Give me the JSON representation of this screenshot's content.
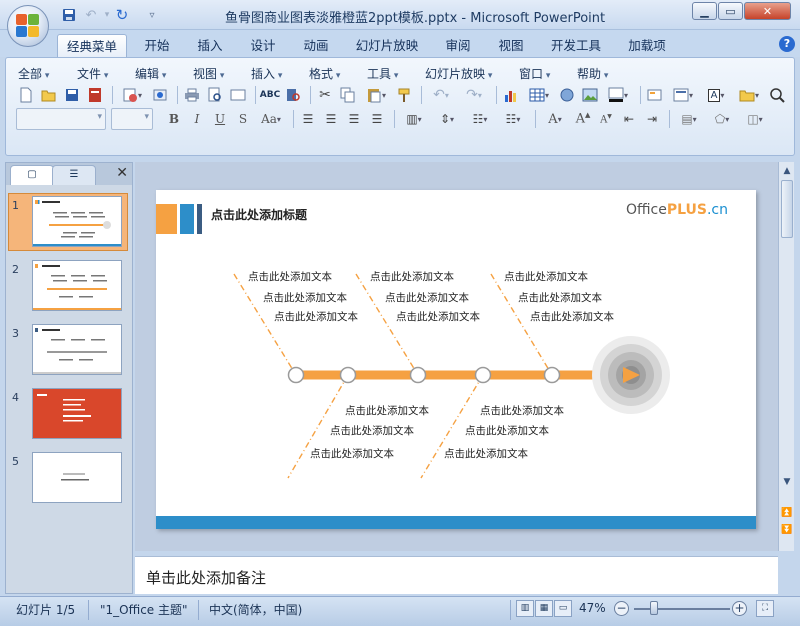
{
  "window": {
    "title": "鱼骨图商业图表淡雅橙蓝2ppt模板.pptx - Microsoft PowerPoint"
  },
  "ribbon_tabs": [
    {
      "label": "经典菜单",
      "active": true
    },
    {
      "label": "开始"
    },
    {
      "label": "插入"
    },
    {
      "label": "设计"
    },
    {
      "label": "动画"
    },
    {
      "label": "幻灯片放映"
    },
    {
      "label": "审阅"
    },
    {
      "label": "视图"
    },
    {
      "label": "开发工具"
    },
    {
      "label": "加载项"
    }
  ],
  "classic_menus": [
    "全部",
    "文件",
    "编辑",
    "视图",
    "插入",
    "格式",
    "工具",
    "幻灯片放映",
    "窗口",
    "帮助"
  ],
  "toolbar_icons": {
    "row1": [
      "new-icon",
      "open-icon",
      "save-icon",
      "pdf-icon",
      "permission-icon",
      "publish-icon",
      "print-icon",
      "print-preview-icon",
      "page-setup-icon",
      "spelling-icon",
      "research-icon",
      "cut-icon",
      "copy-icon",
      "paste-icon",
      "format-painter-icon",
      "undo-icon",
      "redo-icon",
      "insert-chart-icon",
      "insert-table-icon",
      "hyperlink-icon",
      "insert-picture-icon",
      "color-icon",
      "new-slide-icon",
      "layout-icon",
      "text-box-icon",
      "folder-icon",
      "zoom-icon"
    ],
    "row2": [
      "bold-icon",
      "italic-icon",
      "underline-icon",
      "strikethrough-icon",
      "change-case-icon",
      "align-left-icon",
      "center-icon",
      "align-right-icon",
      "justify-icon",
      "columns-icon",
      "line-spacing-icon",
      "numbering-icon",
      "bullets-icon",
      "grow-font-icon",
      "shrink-font-icon",
      "decrease-indent-icon",
      "increase-indent-icon",
      "arrange-icon",
      "shapes-icon",
      "quick-styles-icon"
    ]
  },
  "left_panel": {
    "thumbnails": [
      {
        "number": "1",
        "selected": true
      },
      {
        "number": "2"
      },
      {
        "number": "3"
      },
      {
        "number": "4"
      },
      {
        "number": "5"
      }
    ]
  },
  "slide": {
    "title": "点击此处添加标题",
    "brand_office": "Office",
    "brand_plus": "PLUS",
    "brand_cn": ".cn",
    "placeholder": "点击此处添加文本",
    "colors": {
      "orange": "#f5a142",
      "blue": "#2d8ec9",
      "dark_blue": "#3b5c82"
    }
  },
  "notes": {
    "placeholder": "单击此处添加备注"
  },
  "status": {
    "slide_info": "幻灯片 1/5",
    "theme": "\"1_Office 主题\"",
    "language": "中文(简体，中国)",
    "zoom": "47%",
    "zoom_level_percent": 47
  }
}
